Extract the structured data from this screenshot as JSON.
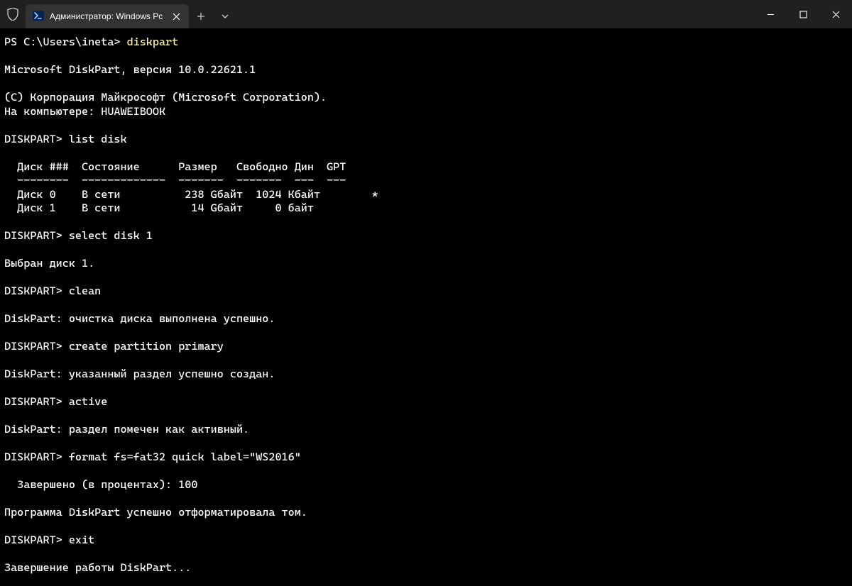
{
  "titlebar": {
    "tab_title": "Администратор: Windows Pc",
    "new_tab_label": "+",
    "close_label": "✕"
  },
  "terminal": {
    "line01_prompt": "PS C:\\Users\\ineta> ",
    "line01_cmd": "diskpart",
    "blank": "",
    "line03": "Microsoft DiskPart, версия 10.0.22621.1",
    "line05": "(C) Корпорация Майкрософт (Microsoft Corporation).",
    "line06": "На компьютере: HUAWEIBOOK",
    "line08_prompt": "DISKPART> ",
    "line08_cmd": "list disk",
    "tbl_header": "  Диск ###  Состояние      Размер   Свободно Дин  GPT",
    "tbl_divider": "  --------  -------------  -------  -------  ---  ---",
    "tbl_row0": "  Диск 0    В сети          238 Gбайт  1024 Кбайт        *",
    "tbl_row1": "  Диск 1    В сети           14 Gбайт     0 байт",
    "line14_prompt": "DISKPART> ",
    "line14_cmd": "select disk 1",
    "line16": "Выбран диск 1.",
    "line18_prompt": "DISKPART> ",
    "line18_cmd": "clean",
    "line20": "DiskPart: очистка диска выполнена успешно.",
    "line22_prompt": "DISKPART> ",
    "line22_cmd": "create partition primary",
    "line24": "DiskPart: указанный раздел успешно создан.",
    "line26_prompt": "DISKPART> ",
    "line26_cmd": "active",
    "line28": "DiskPart: раздел помечен как активный.",
    "line30_prompt": "DISKPART> ",
    "line30_cmd": "format fs=fat32 quick label=\"WS2016\"",
    "line32": "  Завершено (в процентах): 100",
    "line34": "Программа DiskPart успешно отформатировала том.",
    "line36_prompt": "DISKPART> ",
    "line36_cmd": "exit",
    "line38": "Завершение работы DiskPart..."
  }
}
